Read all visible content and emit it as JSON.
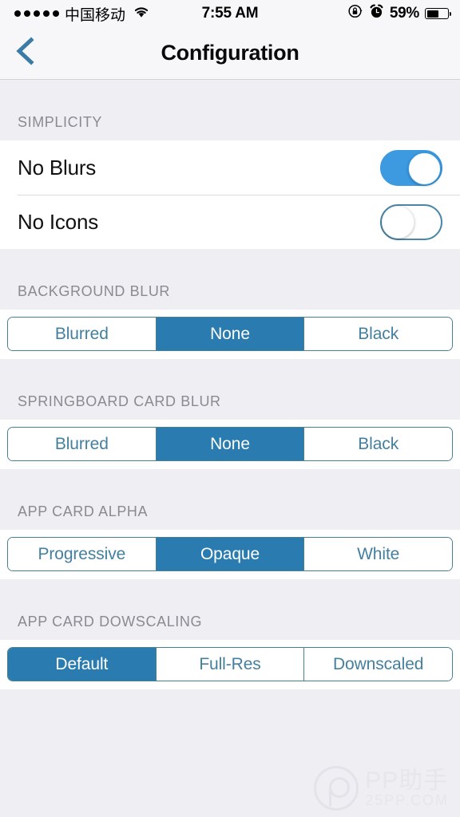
{
  "status_bar": {
    "signal_dots": 5,
    "carrier": "中国移动",
    "wifi_icon": "wifi-icon",
    "time": "7:55 AM",
    "rotation_lock_icon": "rotation-lock-icon",
    "alarm_icon": "alarm-clock-icon",
    "battery_percent": "59%",
    "battery_level": 59
  },
  "nav": {
    "back_icon": "chevron-left-icon",
    "title": "Configuration"
  },
  "sections": {
    "simplicity": {
      "header": "SIMPLICITY",
      "rows": [
        {
          "label": "No Blurs",
          "state": "on"
        },
        {
          "label": "No Icons",
          "state": "off"
        }
      ]
    },
    "background_blur": {
      "header": "BACKGROUND BLUR",
      "options": [
        "Blurred",
        "None",
        "Black"
      ],
      "selected": "None",
      "selected_index": 1
    },
    "springboard_card_blur": {
      "header": "SPRINGBOARD CARD BLUR",
      "options": [
        "Blurred",
        "None",
        "Black"
      ],
      "selected": "None",
      "selected_index": 1
    },
    "app_card_alpha": {
      "header": "APP CARD ALPHA",
      "options": [
        "Progressive",
        "Opaque",
        "White"
      ],
      "selected": "Opaque",
      "selected_index": 1
    },
    "app_card_downscaling": {
      "header": "APP CARD DOWSCALING",
      "options": [
        "Default",
        "Full-Res",
        "Downscaled"
      ],
      "selected": "Default",
      "selected_index": 0
    }
  },
  "watermark": {
    "name": "PP助手",
    "url": "25PP.COM"
  },
  "colors": {
    "accent_selected": "#2a7bb0",
    "segment_text": "#44809e",
    "segment_border": "#4a7f8f",
    "switch_on": "#3d9ae0",
    "switch_off_border": "#4a87a6",
    "back_chevron": "#3a7ca5",
    "page_background": "#eeeef3",
    "row_background": "#ffffff",
    "header_text": "#8a8a90"
  }
}
